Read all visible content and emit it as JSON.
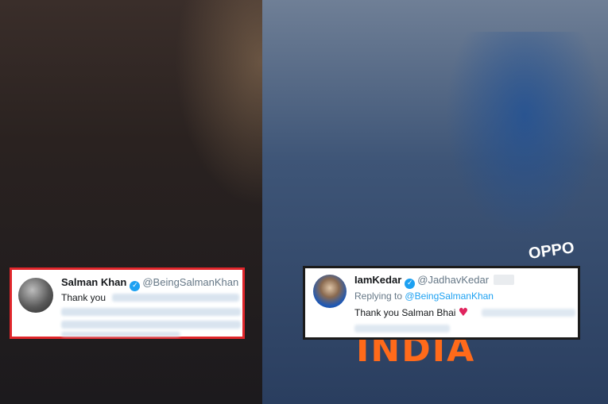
{
  "tweets": {
    "left": {
      "name": "Salman Khan",
      "handle": "@BeingSalmanKhan",
      "text": "Thank you",
      "verified_icon": "verified-check-icon"
    },
    "right": {
      "name": "IamKedar",
      "handle": "@JadhavKedar",
      "reply_prefix": "Replying to",
      "reply_mention": "@BeingSalmanKhan",
      "text": "Thank you Salman Bhai",
      "heart_icon": "red-heart-icon",
      "verified_icon": "verified-check-icon"
    }
  },
  "photo": {
    "jersey_text": "INDIA",
    "sponsor_text": "OPPO"
  },
  "colors": {
    "left_border": "#e0262b",
    "right_border": "#1b1b1b",
    "twitter_blue": "#1da1f2",
    "heart": "#e0245e"
  }
}
